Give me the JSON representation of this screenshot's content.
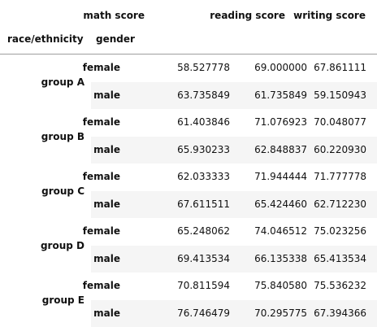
{
  "table": {
    "columns": [
      "math score",
      "reading score",
      "writing score"
    ],
    "index_names": [
      "race/ethnicity",
      "gender"
    ],
    "groups": [
      {
        "name": "group A",
        "rows": [
          {
            "gender": "female",
            "values": [
              "58.527778",
              "69.000000",
              "67.861111"
            ]
          },
          {
            "gender": "male",
            "values": [
              "63.735849",
              "61.735849",
              "59.150943"
            ]
          }
        ]
      },
      {
        "name": "group B",
        "rows": [
          {
            "gender": "female",
            "values": [
              "61.403846",
              "71.076923",
              "70.048077"
            ]
          },
          {
            "gender": "male",
            "values": [
              "65.930233",
              "62.848837",
              "60.220930"
            ]
          }
        ]
      },
      {
        "name": "group C",
        "rows": [
          {
            "gender": "female",
            "values": [
              "62.033333",
              "71.944444",
              "71.777778"
            ]
          },
          {
            "gender": "male",
            "values": [
              "67.611511",
              "65.424460",
              "62.712230"
            ]
          }
        ]
      },
      {
        "name": "group D",
        "rows": [
          {
            "gender": "female",
            "values": [
              "65.248062",
              "74.046512",
              "75.023256"
            ]
          },
          {
            "gender": "male",
            "values": [
              "69.413534",
              "66.135338",
              "65.413534"
            ]
          }
        ]
      },
      {
        "name": "group E",
        "rows": [
          {
            "gender": "female",
            "values": [
              "70.811594",
              "75.840580",
              "75.536232"
            ]
          },
          {
            "gender": "male",
            "values": [
              "76.746479",
              "70.295775",
              "67.394366"
            ]
          }
        ]
      }
    ]
  },
  "colors": {
    "shaded_row": "#f5f5f5",
    "header_rule": "#9e9e9e",
    "text": "#111111"
  }
}
